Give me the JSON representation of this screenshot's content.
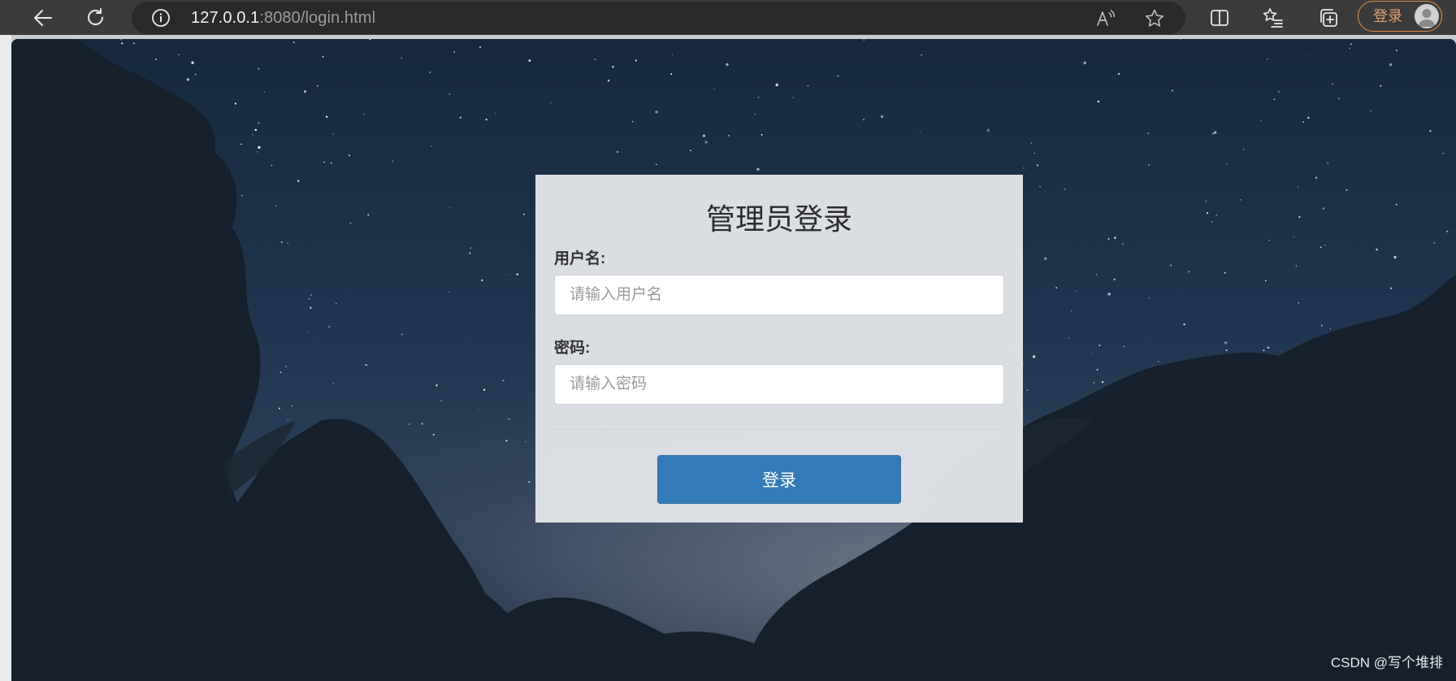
{
  "browser": {
    "url_host": "127.0.0.1",
    "url_rest": ":8080/login.html",
    "account_button_label": "登录",
    "icons": [
      "back-arrow-icon",
      "refresh-icon",
      "info-icon",
      "read-aloud-icon",
      "favorite-star-icon",
      "split-screen-icon",
      "favorites-list-icon",
      "collections-icon",
      "profile-avatar-icon"
    ]
  },
  "login_form": {
    "title": "管理员登录",
    "username_label": "用户名:",
    "username_placeholder": "请输入用户名",
    "password_label": "密码:",
    "password_placeholder": "请输入密码",
    "submit_label": "登录"
  },
  "watermark": "CSDN @写个堆排",
  "colors": {
    "toolbar": "#3b3b3b",
    "address_bar": "#2a2a2a",
    "account_accent": "#e08a45",
    "card_background": "#e2e5e9",
    "button_primary": "#337ab7"
  }
}
